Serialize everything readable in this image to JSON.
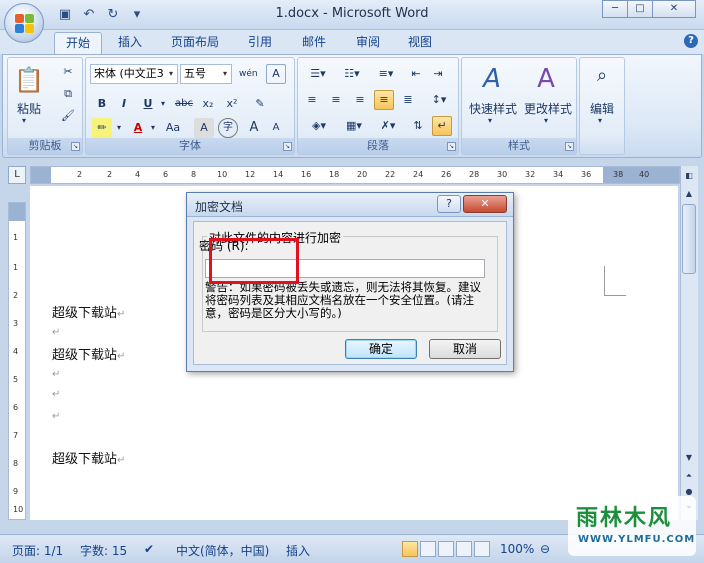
{
  "window": {
    "title": "1.docx - Microsoft Word",
    "minimize": "─",
    "maximize": "□",
    "close": "✕"
  },
  "qat": {
    "icons": [
      "save-icon",
      "undo-icon",
      "redo-icon",
      "customize-icon"
    ]
  },
  "tabs": [
    {
      "label": "开始",
      "active": true
    },
    {
      "label": "插入"
    },
    {
      "label": "页面布局"
    },
    {
      "label": "引用"
    },
    {
      "label": "邮件"
    },
    {
      "label": "审阅"
    },
    {
      "label": "视图"
    }
  ],
  "ribbon": {
    "clipboard": {
      "label": "剪贴板",
      "paste": "粘贴"
    },
    "font": {
      "label": "字体",
      "font_name": "宋体 (中文正3",
      "font_size": "五号",
      "bold": "B",
      "italic": "I",
      "underline": "U",
      "strike": "abc",
      "subscript": "x₂",
      "superscript": "x²",
      "grow": "A",
      "shrink": "A",
      "case": "Aa",
      "border_char": "A",
      "enclose": "字",
      "shading": "A"
    },
    "paragraph": {
      "label": "段落"
    },
    "styles": {
      "label": "样式",
      "quick": "快速样式",
      "change": "更改样式"
    },
    "editing": {
      "label": "编辑"
    }
  },
  "ruler": {
    "h_ticks": [
      "2",
      "2",
      "4",
      "6",
      "8",
      "10",
      "12",
      "14",
      "16",
      "18",
      "20",
      "22",
      "24",
      "26",
      "28",
      "30",
      "32",
      "34",
      "36",
      "38",
      "40"
    ],
    "v_ticks": [
      "1",
      "1",
      "2",
      "3",
      "4",
      "5",
      "6",
      "7",
      "8",
      "9",
      "10"
    ]
  },
  "document": {
    "lines": [
      "超级下载站",
      "",
      "超级下载站",
      "",
      "",
      "",
      "超级下载站"
    ],
    "para_mark": "↵"
  },
  "dialog": {
    "title": "加密文档",
    "help": "?",
    "close": "✕",
    "group_label": "对此文件的内容进行加密",
    "password_label": "密码 (R):",
    "password_value": "",
    "warning": "警告：如果密码被丢失或遗忘，则无法将其恢复。建议将密码列表及其相应文档名放在一个安全位置。(请注意，密码是区分大小写的。)",
    "ok": "确定",
    "cancel": "取消"
  },
  "statusbar": {
    "page": "页面: 1/1",
    "words": "字数: 15",
    "language": "中文(简体，中国)",
    "mode": "插入",
    "zoom": "100%"
  },
  "watermark": {
    "main": "雨林木风",
    "sub": "WWW.YLMFU.COM"
  }
}
